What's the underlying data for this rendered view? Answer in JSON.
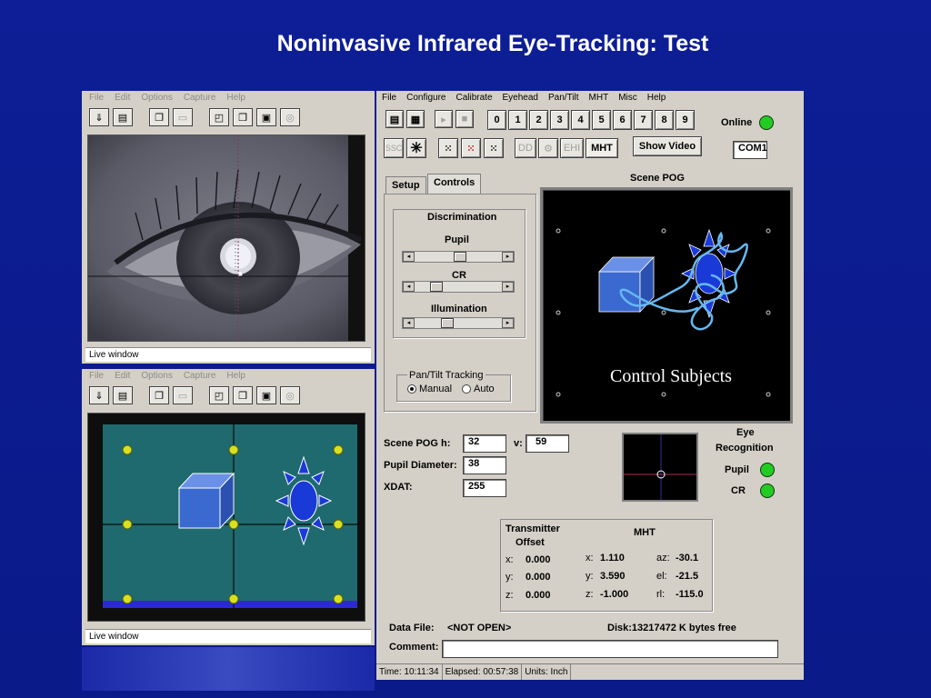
{
  "slide": {
    "title": "Noninvasive Infrared Eye-Tracking: Test"
  },
  "video_window": {
    "menu": [
      "File",
      "Edit",
      "Options",
      "Capture",
      "Help"
    ],
    "status": "Live window"
  },
  "scene_window": {
    "menu": [
      "File",
      "Edit",
      "Options",
      "Capture",
      "Help"
    ],
    "status": "Live window"
  },
  "main": {
    "menu": [
      "File",
      "Configure",
      "Calibrate",
      "Eyehead",
      "Pan/Tilt",
      "MHT",
      "Misc",
      "Help"
    ],
    "digits": [
      "0",
      "1",
      "2",
      "3",
      "4",
      "5",
      "6",
      "7",
      "8",
      "9"
    ],
    "toolbar2": {
      "ssc": "SSC",
      "dd": "DD",
      "ehi": "EHI",
      "mht": "MHT",
      "show_video": "Show Video"
    },
    "online_label": "Online",
    "com_port": "COM1",
    "tabs": [
      "Setup",
      "Controls"
    ],
    "discrimination": {
      "title": "Discrimination",
      "pupil_label": "Pupil",
      "cr_label": "CR",
      "illumination_label": "Illumination",
      "pupil_level": 0.52,
      "cr_level": 0.2,
      "illumination_level": 0.35
    },
    "pantilt": {
      "title": "Pan/Tilt Tracking",
      "manual": "Manual",
      "auto": "Auto",
      "selected": "Manual"
    },
    "scene_pog_title": "Scene POG",
    "scene_overlay_text": "Control Subjects",
    "readouts": {
      "scene_pog_label": "Scene POG  h:",
      "h_value": "32",
      "v_label": "v:",
      "v_value": "59",
      "pupil_diameter_label": "Pupil Diameter:",
      "pupil_diameter_value": "38",
      "xdat_label": "XDAT:",
      "xdat_value": "255"
    },
    "recognition": {
      "title_line1": "Eye",
      "title_line2": "Recognition",
      "pupil": "Pupil",
      "cr": "CR"
    },
    "transmitter": {
      "title_line1": "Transmitter",
      "title_line2": "Offset",
      "x_label": "x:",
      "x": "0.000",
      "y_label": "y:",
      "y": "0.000",
      "z_label": "z:",
      "z": "0.000"
    },
    "mht": {
      "title": "MHT",
      "x_label": "x:",
      "x": "1.110",
      "y_label": "y:",
      "y": "3.590",
      "z_label": "z:",
      "z": "-1.000",
      "az_label": "az:",
      "az": "-30.1",
      "el_label": "el:",
      "el": "-21.5",
      "rl_label": "rl:",
      "rl": "-115.0"
    },
    "data_file_label": "Data File:",
    "data_file_value": "<NOT OPEN>",
    "disk_info": "Disk:13217472   K bytes free",
    "comment_label": "Comment:",
    "comment_value": "",
    "status": {
      "time": "Time: 10:11:34",
      "elapsed": "Elapsed: 00:57:38",
      "units": "Units: Inch"
    }
  }
}
